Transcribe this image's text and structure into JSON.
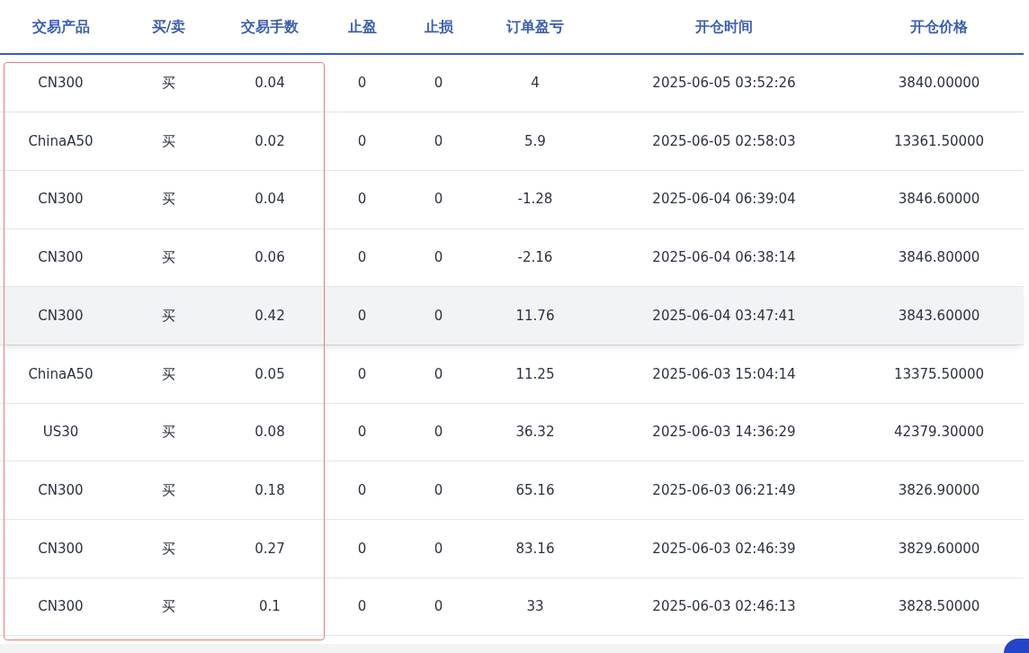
{
  "table": {
    "columns": [
      {
        "label": "交易产品",
        "framed": true
      },
      {
        "label": "买/卖",
        "framed": true
      },
      {
        "label": "交易手数",
        "framed": true
      },
      {
        "label": "止盈",
        "framed": false
      },
      {
        "label": "止损",
        "framed": false
      },
      {
        "label": "订单盈亏",
        "framed": false
      },
      {
        "label": "开仓时间",
        "framed": false
      },
      {
        "label": "开仓价格",
        "framed": false
      }
    ],
    "rows": [
      {
        "hovered": false,
        "cells": [
          "CN300",
          "买",
          "0.04",
          "0",
          "0",
          "4",
          "2025-06-05 03:52:26",
          "3840.00000"
        ]
      },
      {
        "hovered": false,
        "cells": [
          "ChinaA50",
          "买",
          "0.02",
          "0",
          "0",
          "5.9",
          "2025-06-05 02:58:03",
          "13361.50000"
        ]
      },
      {
        "hovered": false,
        "cells": [
          "CN300",
          "买",
          "0.04",
          "0",
          "0",
          "-1.28",
          "2025-06-04 06:39:04",
          "3846.60000"
        ]
      },
      {
        "hovered": false,
        "cells": [
          "CN300",
          "买",
          "0.06",
          "0",
          "0",
          "-2.16",
          "2025-06-04 06:38:14",
          "3846.80000"
        ]
      },
      {
        "hovered": true,
        "cells": [
          "CN300",
          "买",
          "0.42",
          "0",
          "0",
          "11.76",
          "2025-06-04 03:47:41",
          "3843.60000"
        ]
      },
      {
        "hovered": false,
        "cells": [
          "ChinaA50",
          "买",
          "0.05",
          "0",
          "0",
          "11.25",
          "2025-06-03 15:04:14",
          "13375.50000"
        ]
      },
      {
        "hovered": false,
        "cells": [
          "US30",
          "买",
          "0.08",
          "0",
          "0",
          "36.32",
          "2025-06-03 14:36:29",
          "42379.30000"
        ]
      },
      {
        "hovered": false,
        "cells": [
          "CN300",
          "买",
          "0.18",
          "0",
          "0",
          "65.16",
          "2025-06-03 06:21:49",
          "3826.90000"
        ]
      },
      {
        "hovered": false,
        "cells": [
          "CN300",
          "买",
          "0.27",
          "0",
          "0",
          "83.16",
          "2025-06-03 02:46:39",
          "3829.60000"
        ]
      },
      {
        "hovered": false,
        "cells": [
          "CN300",
          "买",
          "0.1",
          "0",
          "0",
          "33",
          "2025-06-03 02:46:13",
          "3828.50000"
        ]
      }
    ]
  }
}
